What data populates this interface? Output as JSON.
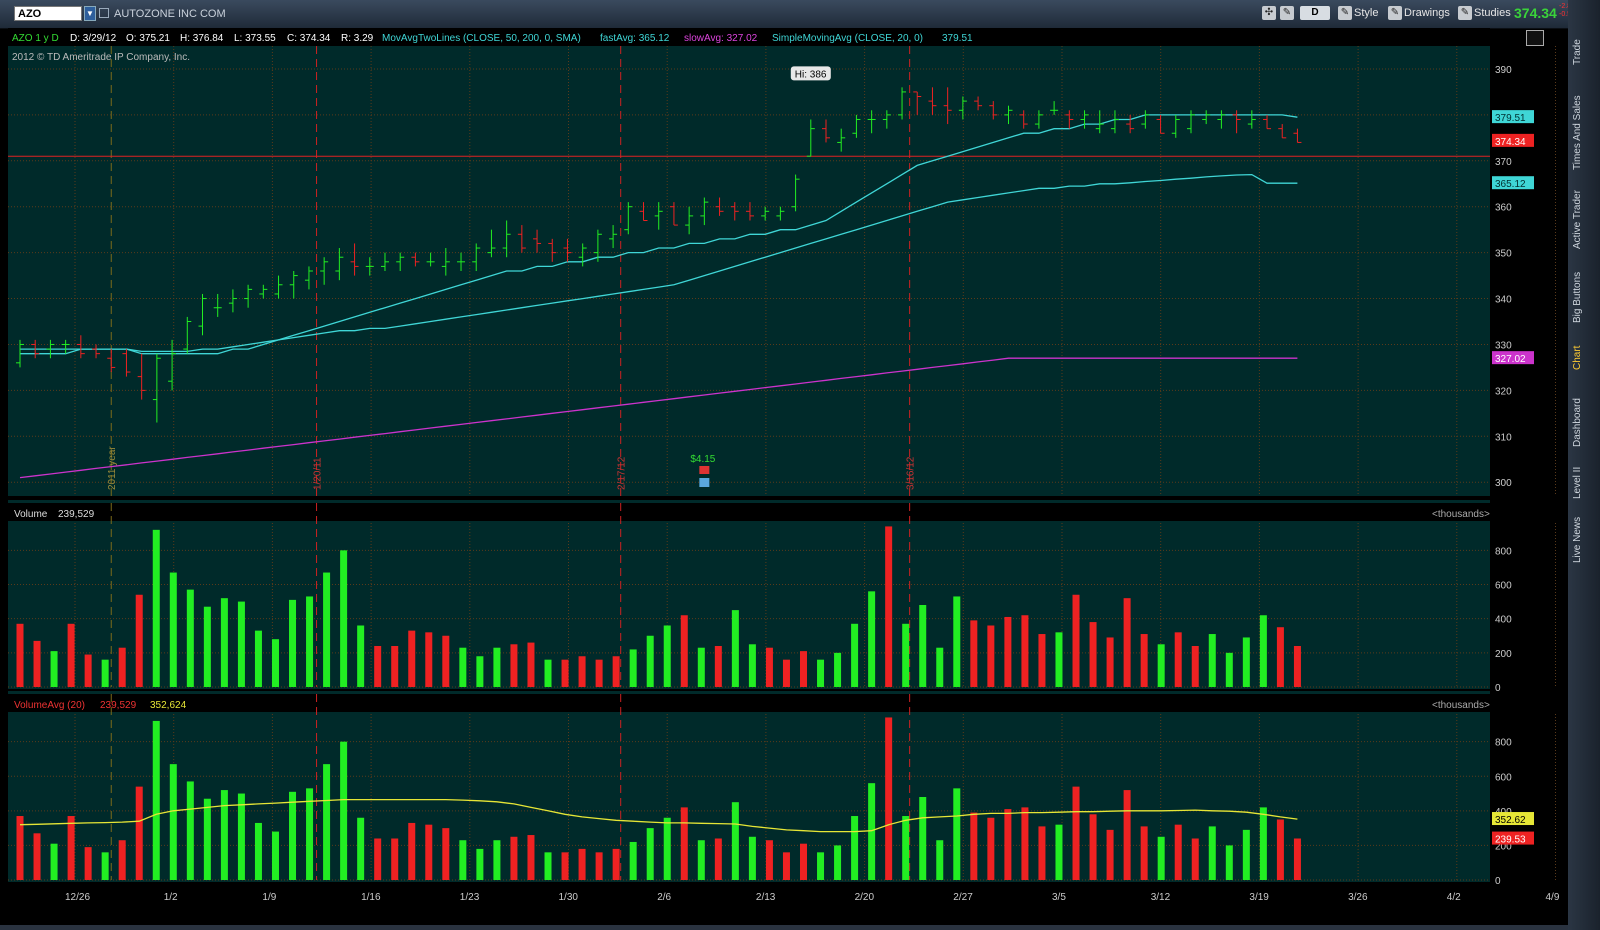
{
  "toolbar": {
    "symbol": "AZO",
    "company": "AUTOZONE INC COM",
    "aggregation": "D",
    "style_label": "Style",
    "drawings_label": "Drawings",
    "studies_label": "Studies",
    "last_price": "374.34",
    "change": "-2.82",
    "change_pct": "-0.54%"
  },
  "sidebar_tabs": [
    "Trade",
    "Times And Sales",
    "Active Trader",
    "Big Buttons",
    "Chart",
    "Dashboard",
    "Level II",
    "Live News"
  ],
  "header": {
    "symbol_period": "AZO 1 y D",
    "date": "D: 3/29/12",
    "open": "O: 375.21",
    "high": "H: 376.84",
    "low": "L: 373.55",
    "close": "C: 374.34",
    "range": "R: 3.29",
    "study1": "MovAvgTwoLines (CLOSE, 50, 200, 0, SMA)",
    "fast_label": "fastAvg: 365.12",
    "slow_label": "slowAvg: 327.02",
    "study2": "SimpleMovingAvg (CLOSE, 20, 0)",
    "sma_value": "379.51"
  },
  "copyright": "2012 © TD Ameritrade IP Company, Inc.",
  "colors": {
    "bg": "#002a2a",
    "up": "#22ee22",
    "down": "#ee2222",
    "sma20": "#3fd6d6",
    "sma50": "#3fd6d6",
    "sma200": "#cc33cc",
    "volavg": "#e6e636",
    "grid": "#5a3a1a"
  },
  "chart_data": [
    {
      "type": "ohlc",
      "y_ticks": [
        300,
        310,
        320,
        330,
        340,
        350,
        360,
        370,
        380,
        390
      ],
      "ylim": [
        297,
        395
      ],
      "x_tick_labels": [
        "12/26",
        "1/2",
        "1/9",
        "1/16",
        "1/23",
        "1/30",
        "2/6",
        "2/13",
        "2/20",
        "2/27",
        "3/5",
        "3/12",
        "3/19",
        "3/26",
        "4/2",
        "4/9"
      ],
      "markers": [
        {
          "label": "2011 year",
          "index": 6
        },
        {
          "label": "1/20/11",
          "index": 19.5
        },
        {
          "label": "2/17/12",
          "index": 39.5
        },
        {
          "label": "3/16/12",
          "index": 58.5
        }
      ],
      "horizontal_line": 371,
      "high_label": "Hi: 386",
      "high_index": 52,
      "dividend_label": "$4.15",
      "dividend_index": 45,
      "price_labels": [
        {
          "text": "379.51",
          "value": 379.51,
          "color": "#3fd6d6"
        },
        {
          "text": "374.34",
          "value": 374.34,
          "color": "#ee2222"
        },
        {
          "text": "365.12",
          "value": 365.12,
          "color": "#3fd6d6"
        },
        {
          "text": "327.02",
          "value": 327.02,
          "color": "#cc33cc"
        }
      ],
      "bars": [
        [
          326,
          331,
          325,
          330
        ],
        [
          330,
          331,
          327,
          328
        ],
        [
          329,
          331,
          327,
          330
        ],
        [
          330,
          331,
          328,
          330
        ],
        [
          330,
          332,
          327,
          328
        ],
        [
          329,
          330,
          327,
          328
        ],
        [
          327,
          329,
          324,
          325
        ],
        [
          328,
          329,
          323,
          324
        ],
        [
          323,
          328,
          318,
          320
        ],
        [
          318,
          328,
          313,
          327
        ],
        [
          322,
          331,
          320,
          328
        ],
        [
          329,
          336,
          328,
          335
        ],
        [
          334,
          341,
          332,
          340
        ],
        [
          338,
          341,
          336,
          338
        ],
        [
          339,
          342,
          337,
          340
        ],
        [
          340,
          343,
          338,
          342
        ],
        [
          341,
          343,
          340,
          342
        ],
        [
          341,
          345,
          340,
          343
        ],
        [
          343,
          346,
          340,
          345
        ],
        [
          344,
          347,
          342,
          346
        ],
        [
          346,
          349,
          343,
          348
        ],
        [
          346,
          351,
          344,
          349
        ],
        [
          348,
          352,
          345,
          347
        ],
        [
          347,
          349,
          345,
          347
        ],
        [
          347,
          350,
          346,
          348
        ],
        [
          348,
          350,
          346,
          349
        ],
        [
          349,
          350,
          347,
          348
        ],
        [
          348,
          350,
          347,
          348
        ],
        [
          347,
          351,
          345,
          348
        ],
        [
          348,
          350,
          346,
          348
        ],
        [
          348,
          352,
          346,
          351
        ],
        [
          350,
          355,
          349,
          351
        ],
        [
          351,
          357,
          349,
          354
        ],
        [
          354,
          356,
          350,
          351
        ],
        [
          353,
          355,
          350,
          352
        ],
        [
          352,
          353,
          348,
          350
        ],
        [
          351,
          353,
          348,
          350
        ],
        [
          349,
          352,
          347,
          351
        ],
        [
          350,
          355,
          348,
          354
        ],
        [
          353,
          356,
          351,
          354
        ],
        [
          355,
          361,
          354,
          360
        ],
        [
          359,
          361,
          357,
          357
        ],
        [
          358,
          361,
          355,
          359
        ],
        [
          360,
          361,
          356,
          356
        ],
        [
          356,
          360,
          354,
          358
        ],
        [
          358,
          362,
          356,
          361
        ],
        [
          360,
          362,
          358,
          359
        ],
        [
          360,
          361,
          357,
          359
        ],
        [
          359,
          361,
          357,
          358
        ],
        [
          358,
          360,
          357,
          359
        ],
        [
          358,
          360,
          357,
          359
        ],
        [
          360,
          367,
          359,
          366
        ],
        [
          371,
          379,
          371,
          377
        ],
        [
          377,
          379,
          374,
          375
        ],
        [
          374,
          377,
          372,
          375
        ],
        [
          376,
          380,
          375,
          379
        ],
        [
          379,
          381,
          376,
          379
        ],
        [
          379,
          381,
          377,
          380
        ],
        [
          380,
          386,
          379,
          385
        ],
        [
          385,
          385,
          380,
          384
        ],
        [
          383,
          386,
          380,
          382
        ],
        [
          382,
          386,
          378,
          381
        ],
        [
          381,
          384,
          379,
          383
        ],
        [
          383,
          384,
          381,
          382
        ],
        [
          382,
          383,
          379,
          380
        ],
        [
          380,
          382,
          378,
          381
        ],
        [
          380,
          381,
          377,
          378
        ],
        [
          378,
          381,
          377,
          380
        ],
        [
          381,
          383,
          380,
          381
        ],
        [
          380,
          381,
          377,
          379
        ],
        [
          379,
          381,
          377,
          380
        ],
        [
          377,
          381,
          376,
          378
        ],
        [
          377,
          381,
          376,
          379
        ],
        [
          378,
          380,
          376,
          377
        ],
        [
          378,
          381,
          377,
          380
        ],
        [
          379,
          380,
          376,
          376
        ],
        [
          376,
          380,
          375,
          379
        ],
        [
          377,
          381,
          376,
          380
        ],
        [
          379,
          381,
          378,
          380
        ],
        [
          379,
          381,
          377,
          380
        ],
        [
          380,
          381,
          376,
          379
        ],
        [
          378,
          381,
          377,
          379
        ],
        [
          379,
          380,
          377,
          377
        ],
        [
          377,
          378,
          375,
          375
        ],
        [
          376,
          377,
          374,
          374
        ]
      ],
      "sma20": [
        328,
        328,
        328,
        328,
        329,
        329,
        329,
        329,
        328,
        328,
        328,
        328,
        328,
        328,
        329,
        329,
        330,
        331,
        332,
        333,
        334,
        335,
        336,
        337,
        338,
        339,
        340,
        341,
        342,
        343,
        344,
        345,
        346,
        346,
        347,
        347,
        348,
        348,
        349,
        349,
        350,
        350,
        351,
        351,
        352,
        352,
        353,
        353,
        354,
        354,
        355,
        355,
        356,
        357,
        359,
        361,
        363,
        365,
        367,
        369,
        370,
        371,
        372,
        373,
        374,
        375,
        376,
        376,
        377,
        377,
        378,
        378,
        379,
        379,
        380,
        380,
        380,
        380,
        380,
        380,
        380,
        380,
        380,
        380,
        379.5
      ],
      "sma50": [
        329,
        329,
        329,
        329,
        329,
        329,
        329,
        329,
        328.5,
        328.5,
        328.5,
        328.5,
        329,
        329,
        329.5,
        330,
        330.5,
        331,
        331.5,
        332,
        332.5,
        333,
        333,
        333.5,
        333.5,
        334,
        334.5,
        335,
        335.5,
        336,
        336.5,
        337,
        337.5,
        338,
        338.5,
        339,
        339.5,
        340,
        340.5,
        341,
        341.5,
        342,
        342.5,
        343,
        344,
        345,
        346,
        347,
        348,
        349,
        350,
        351,
        352,
        353,
        354,
        355,
        356,
        357,
        358,
        359,
        360,
        361,
        361.5,
        362,
        362.5,
        363,
        363.5,
        364,
        364,
        364.5,
        364.5,
        365,
        365,
        365.2,
        365.5,
        365.7,
        366,
        366.2,
        366.5,
        366.7,
        366.9,
        367,
        365.12,
        365.12,
        365.12
      ],
      "sma200": [
        301,
        301.4,
        301.8,
        302.2,
        302.6,
        303,
        303.4,
        303.8,
        304.2,
        304.6,
        305,
        305.4,
        305.8,
        306.2,
        306.6,
        307,
        307.4,
        307.8,
        308.2,
        308.6,
        309,
        309.4,
        309.8,
        310.2,
        310.6,
        311,
        311.4,
        311.8,
        312.2,
        312.6,
        313,
        313.4,
        313.8,
        314.2,
        314.6,
        315,
        315.4,
        315.8,
        316.2,
        316.6,
        317,
        317.4,
        317.8,
        318.2,
        318.6,
        319,
        319.4,
        319.8,
        320.2,
        320.6,
        321,
        321.4,
        321.8,
        322.2,
        322.6,
        323,
        323.4,
        323.8,
        324.2,
        324.6,
        325,
        325.4,
        325.8,
        326.2,
        326.6,
        327.02,
        327.02,
        327.02,
        327.02,
        327.02,
        327.02,
        327.02,
        327.02,
        327.02,
        327.02,
        327.02,
        327.02,
        327.02,
        327.02,
        327.02,
        327.02,
        327.02,
        327.02,
        327.02,
        327.02
      ]
    },
    {
      "type": "bar",
      "title": "Volume",
      "value": "239,529",
      "unit": "<thousands>",
      "y_ticks": [
        0,
        200,
        400,
        600,
        800
      ],
      "ylim": [
        0,
        960
      ],
      "values": [
        370,
        270,
        210,
        370,
        190,
        160,
        230,
        540,
        920,
        670,
        570,
        470,
        520,
        500,
        330,
        280,
        510,
        530,
        670,
        800,
        360,
        240,
        240,
        330,
        320,
        300,
        230,
        180,
        230,
        250,
        260,
        160,
        160,
        180,
        160,
        180,
        220,
        300,
        360,
        420,
        230,
        240,
        450,
        250,
        230,
        160,
        210,
        160,
        200,
        370,
        560,
        940,
        370,
        480,
        230,
        530,
        390,
        360,
        410,
        420,
        310,
        320,
        540,
        380,
        290,
        520,
        310,
        250,
        320,
        240,
        310,
        200,
        290,
        420,
        350,
        240
      ],
      "up": [
        0,
        0,
        1,
        0,
        0,
        1,
        0,
        0,
        1,
        1,
        1,
        1,
        1,
        1,
        1,
        1,
        1,
        1,
        1,
        1,
        1,
        0,
        0,
        0,
        0,
        0,
        1,
        1,
        1,
        0,
        0,
        1,
        0,
        0,
        0,
        0,
        1,
        1,
        1,
        0,
        1,
        0,
        1,
        1,
        0,
        0,
        0,
        1,
        1,
        1,
        1,
        0,
        1,
        1,
        1,
        1,
        0,
        0,
        0,
        0,
        0,
        1,
        0,
        0,
        0,
        0,
        0,
        1,
        0,
        0,
        1,
        1,
        1,
        1,
        0,
        0
      ]
    },
    {
      "type": "bar",
      "title": "VolumeAvg (20)",
      "value": "239,529",
      "avg_value": "352,624",
      "unit": "<thousands>",
      "y_ticks": [
        0,
        200,
        400,
        600,
        800
      ],
      "ylim": [
        0,
        960
      ],
      "avg_labels": [
        {
          "text": "352.62",
          "value": 352.62,
          "color": "#e6e636"
        },
        {
          "text": "239.53",
          "value": 239.53,
          "color": "#ee2222"
        }
      ],
      "avg": [
        320,
        322,
        325,
        328,
        330,
        332,
        335,
        340,
        380,
        400,
        410,
        420,
        430,
        435,
        440,
        445,
        450,
        455,
        460,
        465,
        465,
        465,
        465,
        465,
        465,
        465,
        462,
        458,
        452,
        440,
        420,
        400,
        380,
        365,
        355,
        345,
        340,
        335,
        330,
        330,
        328,
        326,
        324,
        310,
        300,
        290,
        285,
        280,
        280,
        280,
        285,
        320,
        345,
        360,
        365,
        370,
        380,
        385,
        385,
        390,
        390,
        392,
        395,
        395,
        398,
        400,
        400,
        400,
        402,
        404,
        400,
        398,
        392,
        380,
        365,
        352
      ]
    }
  ]
}
